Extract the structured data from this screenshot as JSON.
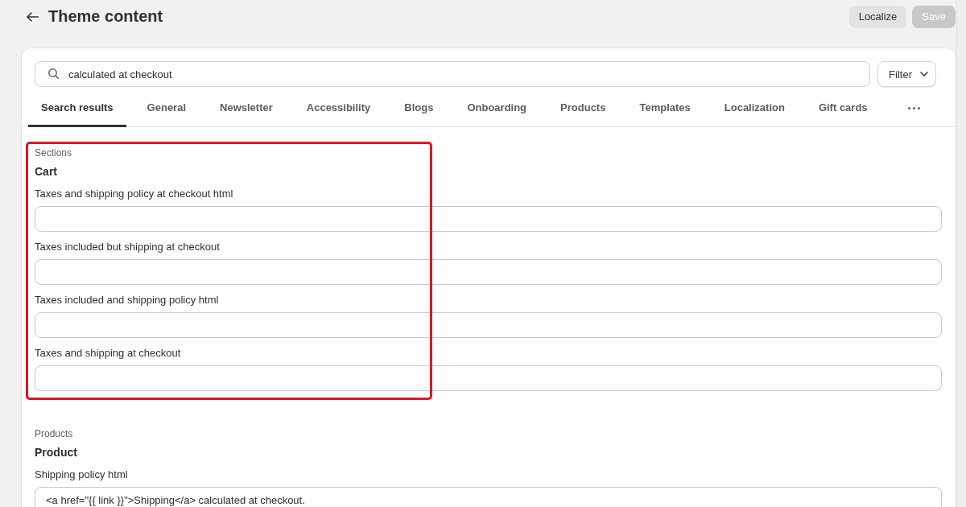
{
  "header": {
    "title": "Theme content"
  },
  "actions": [
    {
      "label": "Localize",
      "disabled": false
    },
    {
      "label": "Save",
      "disabled": true
    }
  ],
  "search": {
    "value": "calculated at checkout"
  },
  "filter": {
    "label": "Filter"
  },
  "tabs": [
    {
      "label": "Search results",
      "selected": true
    },
    {
      "label": "General",
      "selected": false
    },
    {
      "label": "Newsletter",
      "selected": false
    },
    {
      "label": "Accessibility",
      "selected": false
    },
    {
      "label": "Blogs",
      "selected": false
    },
    {
      "label": "Onboarding",
      "selected": false
    },
    {
      "label": "Products",
      "selected": false
    },
    {
      "label": "Templates",
      "selected": false
    },
    {
      "label": "Localization",
      "selected": false
    },
    {
      "label": "Gift cards",
      "selected": false
    }
  ],
  "groups": [
    {
      "category": "Sections",
      "name": "Cart",
      "highlighted": true,
      "fields": [
        {
          "label": "Taxes and shipping policy at checkout html"
        },
        {
          "label": "Taxes included but shipping at checkout"
        },
        {
          "label": "Taxes included and shipping policy html"
        },
        {
          "label": "Taxes and shipping at checkout"
        }
      ]
    },
    {
      "category": "Products",
      "name": "Product",
      "highlighted": false,
      "fields": [
        {
          "label": "Shipping policy html",
          "value": "<a href=\"{{ link }}\">Shipping</a> calculated at checkout."
        }
      ]
    }
  ]
}
